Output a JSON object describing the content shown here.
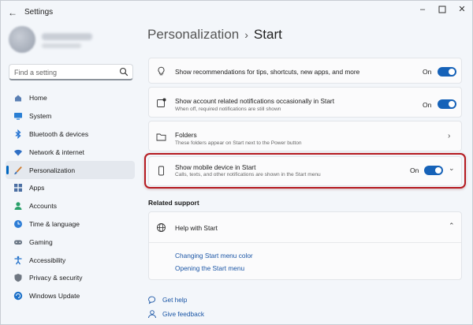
{
  "window": {
    "app_title": "Settings",
    "minimize_icon": "minimize-icon",
    "maximize_icon": "maximize-icon",
    "close_icon": "close-icon"
  },
  "search": {
    "placeholder": "Find a setting"
  },
  "sidebar": {
    "items": [
      {
        "label": "Home",
        "icon": "home-icon",
        "color": "#5a7fb3"
      },
      {
        "label": "System",
        "icon": "monitor-icon",
        "color": "#2a7fd4"
      },
      {
        "label": "Bluetooth & devices",
        "icon": "bluetooth-icon",
        "color": "#1d6fd1"
      },
      {
        "label": "Network & internet",
        "icon": "wifi-icon",
        "color": "#2f6fc4"
      },
      {
        "label": "Personalization",
        "icon": "brush-icon",
        "color": "#d07a2c",
        "active": true
      },
      {
        "label": "Apps",
        "icon": "apps-icon",
        "color": "#4c6fa3"
      },
      {
        "label": "Accounts",
        "icon": "person-icon",
        "color": "#2aa06a"
      },
      {
        "label": "Time & language",
        "icon": "globe-clock-icon",
        "color": "#2d7dd6"
      },
      {
        "label": "Gaming",
        "icon": "controller-icon",
        "color": "#6b7785"
      },
      {
        "label": "Accessibility",
        "icon": "accessibility-icon",
        "color": "#1f6fc9"
      },
      {
        "label": "Privacy & security",
        "icon": "shield-icon",
        "color": "#6f7781"
      },
      {
        "label": "Windows Update",
        "icon": "update-icon",
        "color": "#1e72c9"
      }
    ]
  },
  "header": {
    "crumb": "Personalization",
    "separator": "›",
    "title": "Start"
  },
  "settings": [
    {
      "title": "Show recommendations for tips, shortcuts, new apps, and more",
      "description": "",
      "state": "On",
      "icon": "lightbulb-icon",
      "toggle": true
    },
    {
      "title": "Show account related notifications occasionally in Start",
      "description": "When off, required notifications are still shown",
      "state": "On",
      "icon": "notification-icon",
      "toggle": true
    },
    {
      "title": "Folders",
      "description": "These folders appear on Start next to the Power button",
      "icon": "folder-icon",
      "chevron": "chevron-right-icon"
    },
    {
      "title": "Show mobile device in Start",
      "description": "Calls, texts, and other notifications are shown in the Start menu",
      "state": "On",
      "icon": "phone-icon",
      "toggle": true,
      "chevron": "chevron-down-icon",
      "highlighted": true
    }
  ],
  "related": {
    "heading": "Related support",
    "help": {
      "title": "Help with Start",
      "icon": "globe-icon",
      "links": [
        "Changing Start menu color",
        "Opening the Start menu"
      ]
    }
  },
  "footer_links": [
    {
      "label": "Get help",
      "icon": "help-icon"
    },
    {
      "label": "Give feedback",
      "icon": "feedback-icon"
    }
  ],
  "colors": {
    "accent": "#1662b8",
    "link": "#1a55a5",
    "highlight": "#b51b21"
  }
}
